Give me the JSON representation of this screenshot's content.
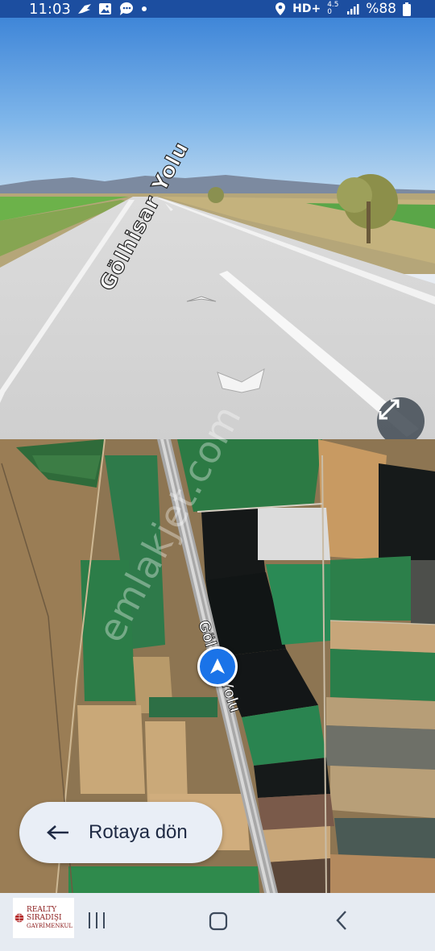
{
  "status_bar": {
    "time": "11:03",
    "left_icons": [
      "bird-notification-icon",
      "gallery-icon",
      "chat-icon",
      "dot-icon"
    ],
    "network_label": "HD+",
    "network_speed": "4.50",
    "battery": "%88"
  },
  "street_view": {
    "road_name": "Gölhisar Yolu",
    "expand_icon": "expand-arrows-icon"
  },
  "map": {
    "road_name_top": "Göl",
    "road_name_bottom": "Yolu",
    "watermark": "emlakjet.com"
  },
  "reroute": {
    "label": "Rotaya dön",
    "icon": "arrow-left-icon"
  },
  "nav_bar": {
    "logo_line1": "REALTY",
    "logo_line2": "SIRADIŞI",
    "logo_line3": "GAYRİMENKUL",
    "buttons": [
      "recents-icon",
      "home-icon",
      "back-icon"
    ]
  },
  "colors": {
    "status_bar": "#1c4ea0",
    "marker": "#1a73e8",
    "button_bg": "#e9eef6"
  }
}
